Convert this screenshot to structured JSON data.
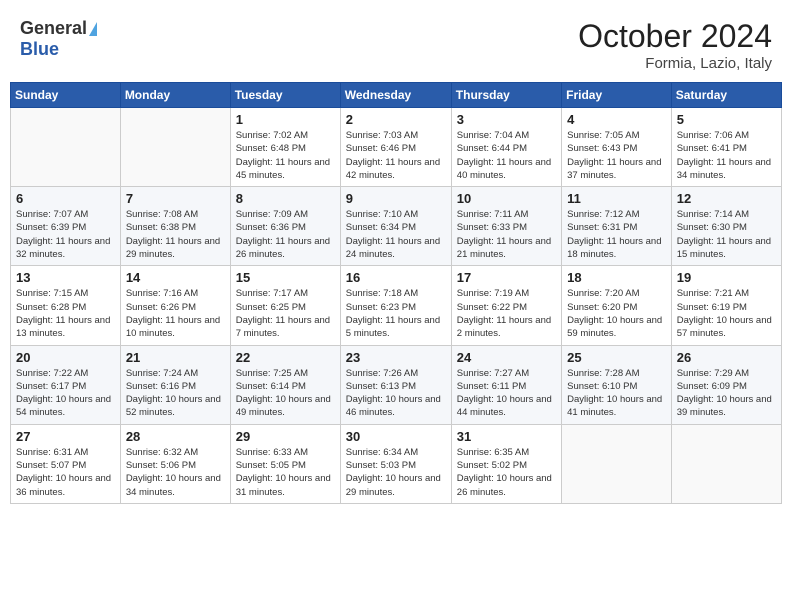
{
  "header": {
    "logo_general": "General",
    "logo_blue": "Blue",
    "month_title": "October 2024",
    "location": "Formia, Lazio, Italy"
  },
  "weekdays": [
    "Sunday",
    "Monday",
    "Tuesday",
    "Wednesday",
    "Thursday",
    "Friday",
    "Saturday"
  ],
  "weeks": [
    [
      {
        "day": "",
        "info": ""
      },
      {
        "day": "",
        "info": ""
      },
      {
        "day": "1",
        "info": "Sunrise: 7:02 AM\nSunset: 6:48 PM\nDaylight: 11 hours and 45 minutes."
      },
      {
        "day": "2",
        "info": "Sunrise: 7:03 AM\nSunset: 6:46 PM\nDaylight: 11 hours and 42 minutes."
      },
      {
        "day": "3",
        "info": "Sunrise: 7:04 AM\nSunset: 6:44 PM\nDaylight: 11 hours and 40 minutes."
      },
      {
        "day": "4",
        "info": "Sunrise: 7:05 AM\nSunset: 6:43 PM\nDaylight: 11 hours and 37 minutes."
      },
      {
        "day": "5",
        "info": "Sunrise: 7:06 AM\nSunset: 6:41 PM\nDaylight: 11 hours and 34 minutes."
      }
    ],
    [
      {
        "day": "6",
        "info": "Sunrise: 7:07 AM\nSunset: 6:39 PM\nDaylight: 11 hours and 32 minutes."
      },
      {
        "day": "7",
        "info": "Sunrise: 7:08 AM\nSunset: 6:38 PM\nDaylight: 11 hours and 29 minutes."
      },
      {
        "day": "8",
        "info": "Sunrise: 7:09 AM\nSunset: 6:36 PM\nDaylight: 11 hours and 26 minutes."
      },
      {
        "day": "9",
        "info": "Sunrise: 7:10 AM\nSunset: 6:34 PM\nDaylight: 11 hours and 24 minutes."
      },
      {
        "day": "10",
        "info": "Sunrise: 7:11 AM\nSunset: 6:33 PM\nDaylight: 11 hours and 21 minutes."
      },
      {
        "day": "11",
        "info": "Sunrise: 7:12 AM\nSunset: 6:31 PM\nDaylight: 11 hours and 18 minutes."
      },
      {
        "day": "12",
        "info": "Sunrise: 7:14 AM\nSunset: 6:30 PM\nDaylight: 11 hours and 15 minutes."
      }
    ],
    [
      {
        "day": "13",
        "info": "Sunrise: 7:15 AM\nSunset: 6:28 PM\nDaylight: 11 hours and 13 minutes."
      },
      {
        "day": "14",
        "info": "Sunrise: 7:16 AM\nSunset: 6:26 PM\nDaylight: 11 hours and 10 minutes."
      },
      {
        "day": "15",
        "info": "Sunrise: 7:17 AM\nSunset: 6:25 PM\nDaylight: 11 hours and 7 minutes."
      },
      {
        "day": "16",
        "info": "Sunrise: 7:18 AM\nSunset: 6:23 PM\nDaylight: 11 hours and 5 minutes."
      },
      {
        "day": "17",
        "info": "Sunrise: 7:19 AM\nSunset: 6:22 PM\nDaylight: 11 hours and 2 minutes."
      },
      {
        "day": "18",
        "info": "Sunrise: 7:20 AM\nSunset: 6:20 PM\nDaylight: 10 hours and 59 minutes."
      },
      {
        "day": "19",
        "info": "Sunrise: 7:21 AM\nSunset: 6:19 PM\nDaylight: 10 hours and 57 minutes."
      }
    ],
    [
      {
        "day": "20",
        "info": "Sunrise: 7:22 AM\nSunset: 6:17 PM\nDaylight: 10 hours and 54 minutes."
      },
      {
        "day": "21",
        "info": "Sunrise: 7:24 AM\nSunset: 6:16 PM\nDaylight: 10 hours and 52 minutes."
      },
      {
        "day": "22",
        "info": "Sunrise: 7:25 AM\nSunset: 6:14 PM\nDaylight: 10 hours and 49 minutes."
      },
      {
        "day": "23",
        "info": "Sunrise: 7:26 AM\nSunset: 6:13 PM\nDaylight: 10 hours and 46 minutes."
      },
      {
        "day": "24",
        "info": "Sunrise: 7:27 AM\nSunset: 6:11 PM\nDaylight: 10 hours and 44 minutes."
      },
      {
        "day": "25",
        "info": "Sunrise: 7:28 AM\nSunset: 6:10 PM\nDaylight: 10 hours and 41 minutes."
      },
      {
        "day": "26",
        "info": "Sunrise: 7:29 AM\nSunset: 6:09 PM\nDaylight: 10 hours and 39 minutes."
      }
    ],
    [
      {
        "day": "27",
        "info": "Sunrise: 6:31 AM\nSunset: 5:07 PM\nDaylight: 10 hours and 36 minutes."
      },
      {
        "day": "28",
        "info": "Sunrise: 6:32 AM\nSunset: 5:06 PM\nDaylight: 10 hours and 34 minutes."
      },
      {
        "day": "29",
        "info": "Sunrise: 6:33 AM\nSunset: 5:05 PM\nDaylight: 10 hours and 31 minutes."
      },
      {
        "day": "30",
        "info": "Sunrise: 6:34 AM\nSunset: 5:03 PM\nDaylight: 10 hours and 29 minutes."
      },
      {
        "day": "31",
        "info": "Sunrise: 6:35 AM\nSunset: 5:02 PM\nDaylight: 10 hours and 26 minutes."
      },
      {
        "day": "",
        "info": ""
      },
      {
        "day": "",
        "info": ""
      }
    ]
  ]
}
